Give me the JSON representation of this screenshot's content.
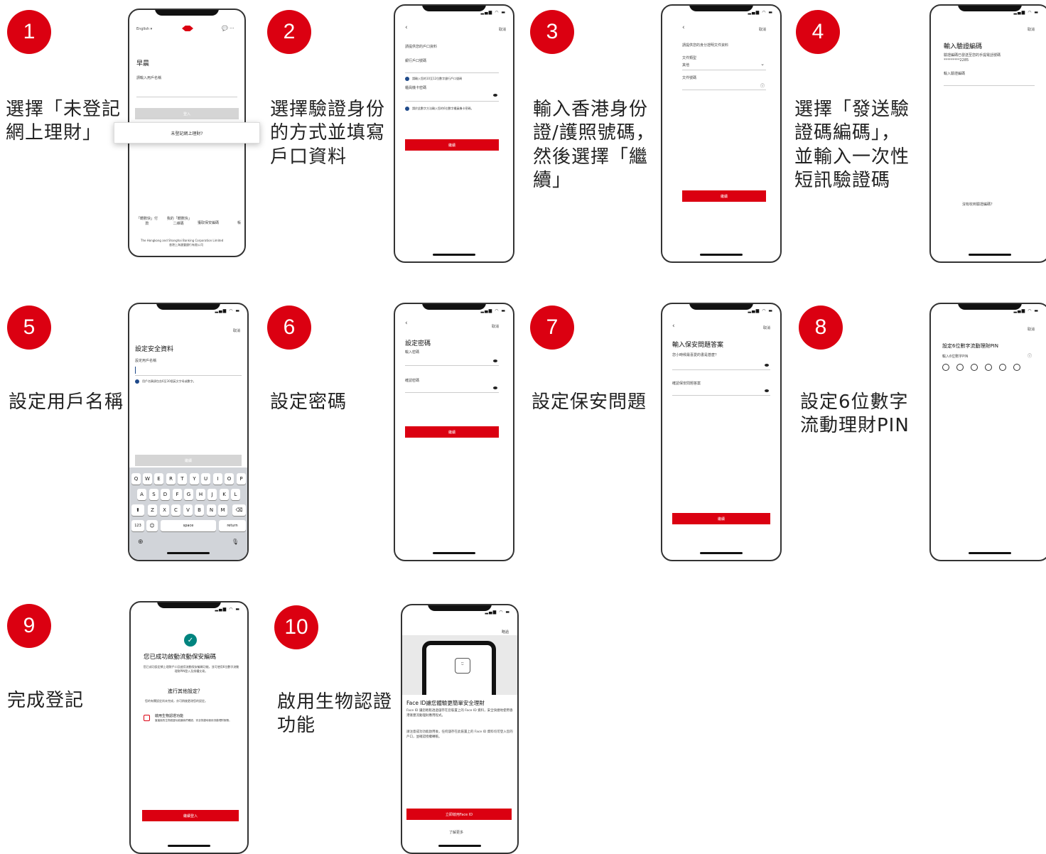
{
  "steps": [
    {
      "num": "1",
      "desc": "選擇「未登記\n網上理財」"
    },
    {
      "num": "2",
      "desc": "選擇驗證身份\n的方式並填寫\n戶口資料"
    },
    {
      "num": "3",
      "desc": "輸入香港身份\n證/護照號碼，\n然後選擇「繼\n續」"
    },
    {
      "num": "4",
      "desc": "選擇「發送驗\n證碼編碼」，\n並輸入一次性\n短訊驗證碼"
    },
    {
      "num": "5",
      "desc": "設定用戶名稱"
    },
    {
      "num": "6",
      "desc": "設定密碼"
    },
    {
      "num": "7",
      "desc": "設定保安問題"
    },
    {
      "num": "8",
      "desc": "設定6位數字\n流動理財PIN"
    },
    {
      "num": "9",
      "desc": "完成登記"
    },
    {
      "num": "10",
      "desc": "啟用生物認證\n功能"
    }
  ],
  "screens": {
    "s1": {
      "lang": "English ▾",
      "greeting": "早晨",
      "username_label": "請輸入用戶名稱",
      "popup": "未登記網上理財?",
      "login_btn": "登入",
      "footer_line1": "The Hongkong and Shanghai Banking Corporation Limited",
      "footer_line2": "香港上海滙豐銀行有限公司",
      "nav": [
        "「轉數快」付款",
        "我的「轉數快」二維碼",
        "獲取保安編碼",
        "帳"
      ]
    },
    "s2": {
      "cancel": "取消",
      "title": "請提供您的戶口資料",
      "field1": "銀行戶口號碼",
      "hint1": "請輸入您的10至12位數字銀行戶口號碼",
      "field2": "櫃員機卡密碼",
      "hint2": "請於此數字方法輸入您的6位數字櫃員機卡密碼。",
      "btn": "繼續"
    },
    "s3": {
      "cancel": "取消",
      "title": "請提供您的身分證明文件資料",
      "field1": "文件類型",
      "value1": "其他",
      "field2": "文件號碼",
      "btn": "繼續"
    },
    "s4": {
      "cancel": "取消",
      "title": "輸入驗證編碼",
      "sub": "驗證編碼已發送至您的手提電話號碼",
      "phone": "*********2285",
      "field": "輸入驗證編碼",
      "link": "沒有收到驗證編碼？"
    },
    "s5": {
      "cancel": "取消",
      "title": "設定安全資料",
      "field": "設定用戶名稱",
      "hint": "用戶名稱須包含6至30個英文字母或數字。",
      "btn": "繼續",
      "keys_row1": [
        "Q",
        "W",
        "E",
        "R",
        "T",
        "Y",
        "U",
        "I",
        "O",
        "P"
      ],
      "keys_row2": [
        "A",
        "S",
        "D",
        "F",
        "G",
        "H",
        "J",
        "K",
        "L"
      ],
      "keys_row3": [
        "Z",
        "X",
        "C",
        "V",
        "B",
        "N",
        "M"
      ],
      "key_123": "123",
      "key_space": "space",
      "key_return": "return"
    },
    "s6": {
      "cancel": "取消",
      "title": "設定密碼",
      "field1": "輸入密碼",
      "field2": "確認密碼",
      "btn": "繼續"
    },
    "s7": {
      "cancel": "取消",
      "title": "輸入保安問題答案",
      "question": "您小時候最喜愛的書是甚麼？",
      "field2": "確認保安問題答案",
      "btn": "繼續"
    },
    "s8": {
      "cancel": "取消",
      "title": "設定6位數字流動理財PIN",
      "field": "輸入6位數字PIN"
    },
    "s9": {
      "title": "您已成功啟動流動保安編碼",
      "desc": "您已成功設定網上理財戶口及啟用流動保安編碼功能，並可使用6位數字流動理財PIN登入及授權交易。",
      "sub_title": "進行其他設定？",
      "sub_desc": "您的有關設定尚未完成，亦可稍後更改您的設定。",
      "option_title": "啟用生物認證功能",
      "option_desc": "當裏面的生物認證功能讓我們確認，安全快捷地使用流動理財服務。",
      "btn": "繼續登入"
    },
    "s10": {
      "skip": "略過",
      "title": "Face ID讓您體驗更簡單安全理財",
      "desc1": "Face ID 讓您輕鬆透過儲存在您裝置上的 Face ID 資料，安全快捷地使用香港滙豐流動理財應用程式。",
      "desc2": "請注意成功功能啟用後，任何儲存在此裝置上的 Face ID 資料均可登入您的戶口，並確認授權轉帳。",
      "btn": "立即啟用Face ID",
      "link": "了解更多"
    }
  },
  "colors": {
    "accent": "#db0011",
    "check": "#00847f"
  }
}
